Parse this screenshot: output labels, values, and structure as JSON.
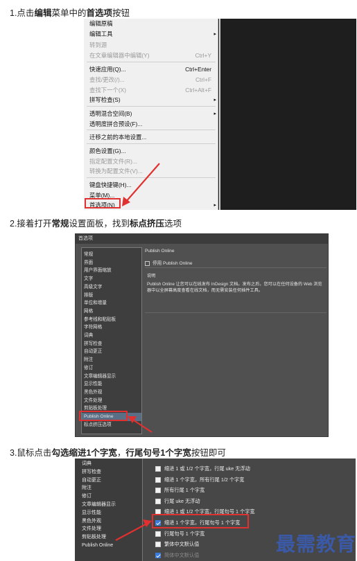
{
  "steps": [
    {
      "prefix": "1.点击",
      "b1": "编辑",
      "mid": "菜单中的",
      "b2": "首选项",
      "suffix": "按钮"
    },
    {
      "prefix": "2.接着打开",
      "b1": "常规",
      "mid": "设置面板，找到",
      "b2": "标点挤压",
      "suffix": "选项"
    },
    {
      "prefix": "3.鼠标点击",
      "b1": "勾选缩进1个字宽",
      "mid": "，",
      "b2": "行尾句号1个字宽",
      "suffix": "按钮即可"
    }
  ],
  "menu": {
    "items": [
      {
        "label": "编辑原稿",
        "shortcut": "",
        "disabled": false,
        "submenu": false
      },
      {
        "label": "编辑工具",
        "shortcut": "",
        "disabled": false,
        "submenu": true
      },
      {
        "label": "转到源",
        "shortcut": "",
        "disabled": true,
        "submenu": false
      },
      {
        "label": "在文章编辑器中编辑(Y)",
        "shortcut": "Ctrl+Y",
        "disabled": true,
        "submenu": false
      },
      {
        "label": "快速应用(Q)...",
        "shortcut": "Ctrl+Enter",
        "disabled": false,
        "submenu": false
      },
      {
        "label": "查找/更改(/)...",
        "shortcut": "Ctrl+F",
        "disabled": true,
        "submenu": false
      },
      {
        "label": "查找下一个(X)",
        "shortcut": "Ctrl+Alt+F",
        "disabled": true,
        "submenu": false
      },
      {
        "label": "拼写检查(S)",
        "shortcut": "",
        "disabled": false,
        "submenu": true
      },
      {
        "label": "透明混合空间(B)",
        "shortcut": "",
        "disabled": false,
        "submenu": true
      },
      {
        "label": "透明度拼合预设(F)...",
        "shortcut": "",
        "disabled": false,
        "submenu": false
      },
      {
        "label": "迁移之前的本地设置...",
        "shortcut": "",
        "disabled": false,
        "submenu": false
      },
      {
        "label": "颜色设置(G)...",
        "shortcut": "",
        "disabled": false,
        "submenu": false
      },
      {
        "label": "指定配置文件(R)...",
        "shortcut": "",
        "disabled": true,
        "submenu": false
      },
      {
        "label": "转换为配置文件(V)...",
        "shortcut": "",
        "disabled": true,
        "submenu": false
      },
      {
        "label": "键盘快捷键(H)...",
        "shortcut": "",
        "disabled": false,
        "submenu": false
      },
      {
        "label": "菜单(M)...",
        "shortcut": "",
        "disabled": false,
        "submenu": false
      },
      {
        "label": "首选项(N)",
        "shortcut": "",
        "disabled": false,
        "submenu": true
      }
    ],
    "colors": {
      "highlight": "#e03030"
    }
  },
  "prefs": {
    "title": "首选项",
    "nav": [
      "常规",
      "界面",
      "用户界面缩放",
      "文字",
      "高级文字",
      "排版",
      "单位和增量",
      "网格",
      "参考线和粘贴板",
      "字符网格",
      "词典",
      "拼写检查",
      "自动更正",
      "附注",
      "修订",
      "文章编辑器显示",
      "显示性能",
      "黑色外观",
      "文件处理",
      "剪贴板处理",
      "Publish Online",
      "标点挤压选项"
    ],
    "panel_title": "Publish Online",
    "checkbox_label": "停用 Publish Online",
    "desc_title": "说明",
    "desc_text": "Publish Online 让您可以在线发布 InDesign 文档。发布之后，您可以在任何设备的 Web 浏览器中以全屏幕高度查看在线文档，而无需安装任何插件工具。"
  },
  "kinsoku": {
    "nav": [
      "词典",
      "拼写检查",
      "自动更正",
      "附注",
      "修订",
      "文章编辑器显示",
      "显示性能",
      "黑色外观",
      "文件处理",
      "剪贴板处理",
      "Publish Online"
    ],
    "options": [
      {
        "label": "缩进 1 或 1/2 个字宽，行尾 uke 无浮动",
        "checked": false,
        "disabled": false
      },
      {
        "label": "缩进 1 个字宽，所有行尾 1/2 个字宽",
        "checked": false,
        "disabled": false
      },
      {
        "label": "所有行尾 1 个字宽",
        "checked": false,
        "disabled": false
      },
      {
        "label": "行尾 uke 无浮动",
        "checked": false,
        "disabled": false
      },
      {
        "label": "缩进 1 或 1/2 个字宽，行尾句号 1 个字宽",
        "checked": false,
        "disabled": false
      },
      {
        "label": "缩进 1 个字宽，行尾句号 1 个字宽",
        "checked": true,
        "disabled": false
      },
      {
        "label": "行尾句号 1 个字宽",
        "checked": false,
        "disabled": false
      },
      {
        "label": "繁体中文默认值",
        "checked": false,
        "disabled": false
      },
      {
        "label": "简体中文默认值",
        "checked": true,
        "disabled": true
      }
    ]
  },
  "watermark": "最需教育"
}
